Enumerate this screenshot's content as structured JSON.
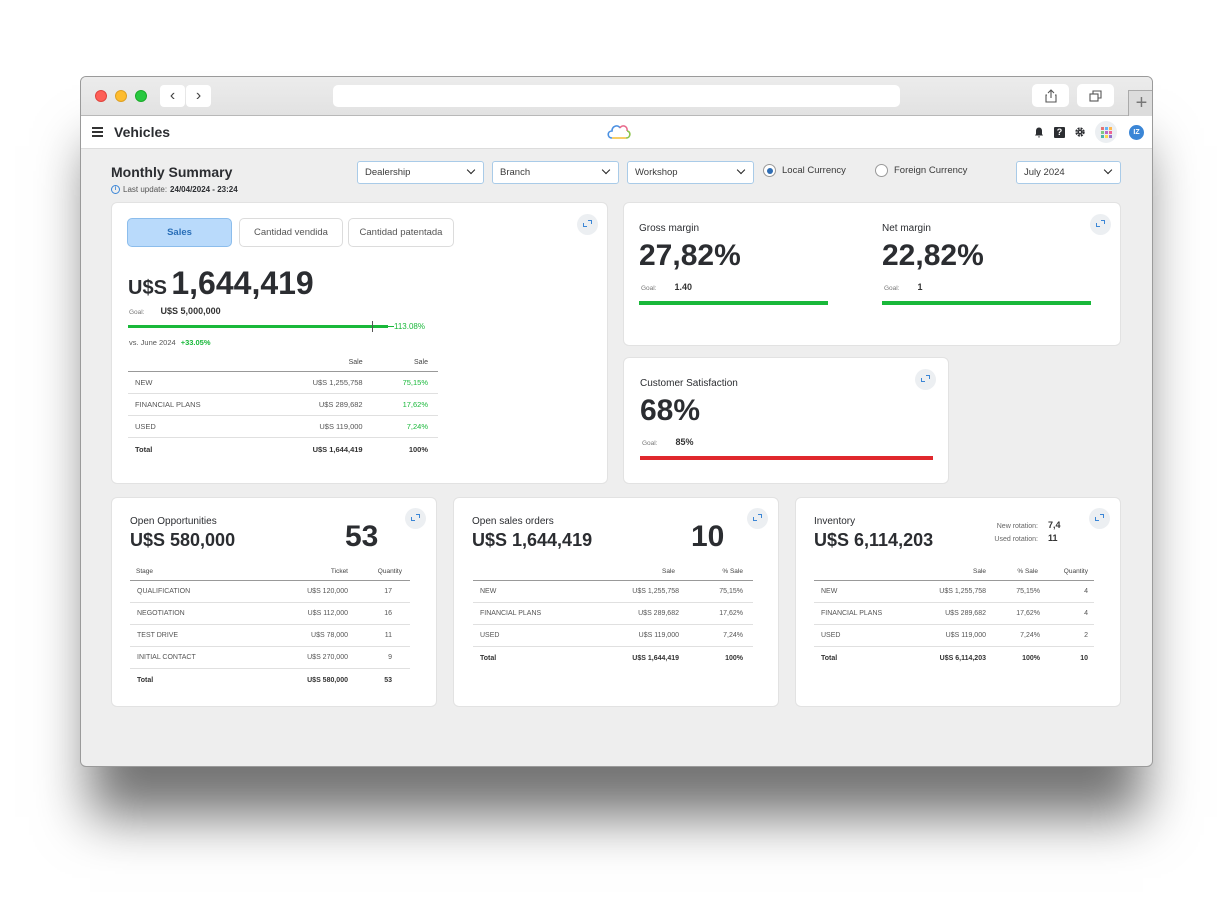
{
  "app": {
    "title": "Vehicles",
    "avatar_initials": "IZ",
    "icons": [
      "hamburger-icon",
      "cloud-logo",
      "bell-icon",
      "help-icon",
      "gear-icon",
      "apps-grid-icon"
    ]
  },
  "browser": {
    "back": "‹",
    "forward": "›",
    "new_tab": "+"
  },
  "header": {
    "title": "Monthly Summary",
    "last_update_label": "Last update:",
    "last_update_value": "24/04/2024 - 23:24"
  },
  "filters": {
    "dealership": "Dealership",
    "branch": "Branch",
    "workshop": "Workshop",
    "currency_options": [
      {
        "label": "Local Currency",
        "selected": true
      },
      {
        "label": "Foreign Currency",
        "selected": false
      }
    ],
    "month": "July 2024"
  },
  "sales_card": {
    "tabs": [
      {
        "label": "Sales",
        "active": true
      },
      {
        "label": "Cantidad vendida",
        "active": false
      },
      {
        "label": "Cantidad patentada",
        "active": false
      }
    ],
    "currency": "U$S",
    "amount": "1,644,419",
    "goal_label": "Goal:",
    "goal_value": "U$S 5,000,000",
    "progress_pct": "113.08%",
    "progress_value": 1.1308,
    "vs_label": "vs. June 2024",
    "vs_value": "+33.05%",
    "table": {
      "headers": [
        "",
        "Sale",
        "Sale"
      ],
      "rows": [
        [
          "NEW",
          "U$S 1,255,758",
          "75,15%"
        ],
        [
          "FINANCIAL PLANS",
          "U$S 289,682",
          "17,62%"
        ],
        [
          "USED",
          "U$S 119,000",
          "7,24%"
        ]
      ],
      "total": [
        "Total",
        "U$S 1,644,419",
        "100%"
      ]
    }
  },
  "margins": {
    "gross": {
      "title": "Gross margin",
      "value": "27,82%",
      "goal_label": "Goal:",
      "goal_value": "1.40",
      "status_color": "#19b83a"
    },
    "net": {
      "title": "Net margin",
      "value": "22,82%",
      "goal_label": "Goal:",
      "goal_value": "1",
      "status_color": "#19b83a"
    }
  },
  "csat": {
    "title": "Customer Satisfaction",
    "value": "68%",
    "goal_label": "Goal:",
    "goal_value": "85%",
    "status_color": "#e0282d"
  },
  "opportunities": {
    "title": "Open Opportunities",
    "amount": "U$S 580,000",
    "count": "53",
    "headers": [
      "Stage",
      "Ticket",
      "Quantity"
    ],
    "rows": [
      [
        "QUALIFICATION",
        "U$S 120,000",
        "17"
      ],
      [
        "NEGOTIATION",
        "U$S 112,000",
        "16"
      ],
      [
        "TEST DRIVE",
        "U$S 78,000",
        "11"
      ],
      [
        "INITIAL CONTACT",
        "U$S 270,000",
        "9"
      ]
    ],
    "total": [
      "Total",
      "U$S 580,000",
      "53"
    ]
  },
  "orders": {
    "title": "Open sales orders",
    "amount": "U$S 1,644,419",
    "count": "10",
    "headers": [
      "",
      "Sale",
      "% Sale"
    ],
    "rows": [
      [
        "NEW",
        "U$S 1,255,758",
        "75,15%"
      ],
      [
        "FINANCIAL PLANS",
        "U$S 289,682",
        "17,62%"
      ],
      [
        "USED",
        "U$S 119,000",
        "7,24%"
      ]
    ],
    "total": [
      "Total",
      "U$S 1,644,419",
      "100%"
    ]
  },
  "inventory": {
    "title": "Inventory",
    "amount": "U$S 6,114,203",
    "new_rotation_label": "New rotation:",
    "new_rotation_value": "7,4",
    "used_rotation_label": "Used rotation:",
    "used_rotation_value": "11",
    "headers": [
      "",
      "Sale",
      "% Sale",
      "Quantity"
    ],
    "rows": [
      [
        "NEW",
        "U$S 1,255,758",
        "75,15%",
        "4"
      ],
      [
        "FINANCIAL PLANS",
        "U$S 289,682",
        "17,62%",
        "4"
      ],
      [
        "USED",
        "U$S 119,000",
        "7,24%",
        "2"
      ]
    ],
    "total": [
      "Total",
      "U$S 6,114,203",
      "100%",
      "10"
    ]
  }
}
